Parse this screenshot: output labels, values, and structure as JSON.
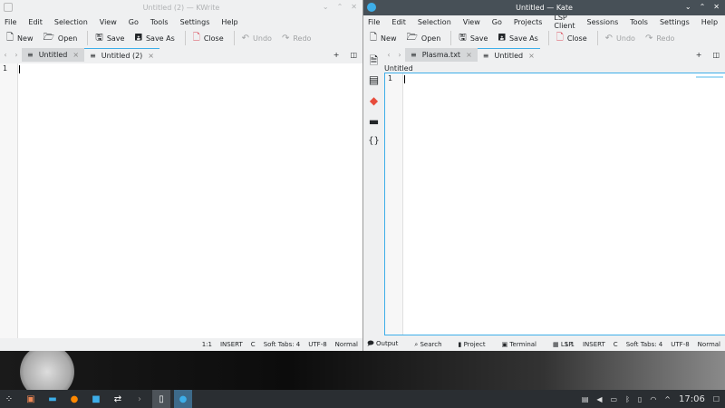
{
  "kwrite": {
    "title": "Untitled (2) — KWrite",
    "menu": [
      "File",
      "Edit",
      "Selection",
      "View",
      "Go",
      "Tools",
      "Settings",
      "Help"
    ],
    "toolbar": {
      "new": "New",
      "open": "Open",
      "save": "Save",
      "save_as": "Save As",
      "close": "Close",
      "undo": "Undo",
      "redo": "Redo"
    },
    "tabs": [
      {
        "label": "Untitled",
        "active": false
      },
      {
        "label": "Untitled (2)",
        "active": true
      }
    ],
    "line_number": "1",
    "status": {
      "position": "1:1",
      "mode": "INSERT",
      "syntax": "C",
      "indent": "Soft Tabs: 4",
      "encoding": "UTF-8",
      "input_mode": "Normal"
    }
  },
  "kate": {
    "title": "Untitled — Kate",
    "menu": [
      "File",
      "Edit",
      "Selection",
      "View",
      "Go",
      "Projects",
      "LSP Client",
      "Sessions",
      "Tools",
      "Settings",
      "Help"
    ],
    "toolbar": {
      "new": "New",
      "open": "Open",
      "save": "Save",
      "save_as": "Save As",
      "close": "Close",
      "undo": "Undo",
      "redo": "Redo"
    },
    "tabs": [
      {
        "label": "Plasma.txt",
        "active": false
      },
      {
        "label": "Untitled",
        "active": true
      }
    ],
    "doc_label": "Untitled",
    "line_number": "1",
    "bottom_tabs": {
      "output": "Output",
      "search": "Search",
      "project": "Project",
      "terminal": "Terminal",
      "lsp": "LSP"
    },
    "status": {
      "position": "1:1",
      "mode": "INSERT",
      "syntax": "C",
      "indent": "Soft Tabs: 4",
      "encoding": "UTF-8",
      "input_mode": "Normal"
    }
  },
  "taskbar": {
    "clock": "17:06"
  },
  "colors": {
    "accent": "#3daee9",
    "kate_titlebar": "#475057",
    "taskbar": "#2a2e32"
  }
}
